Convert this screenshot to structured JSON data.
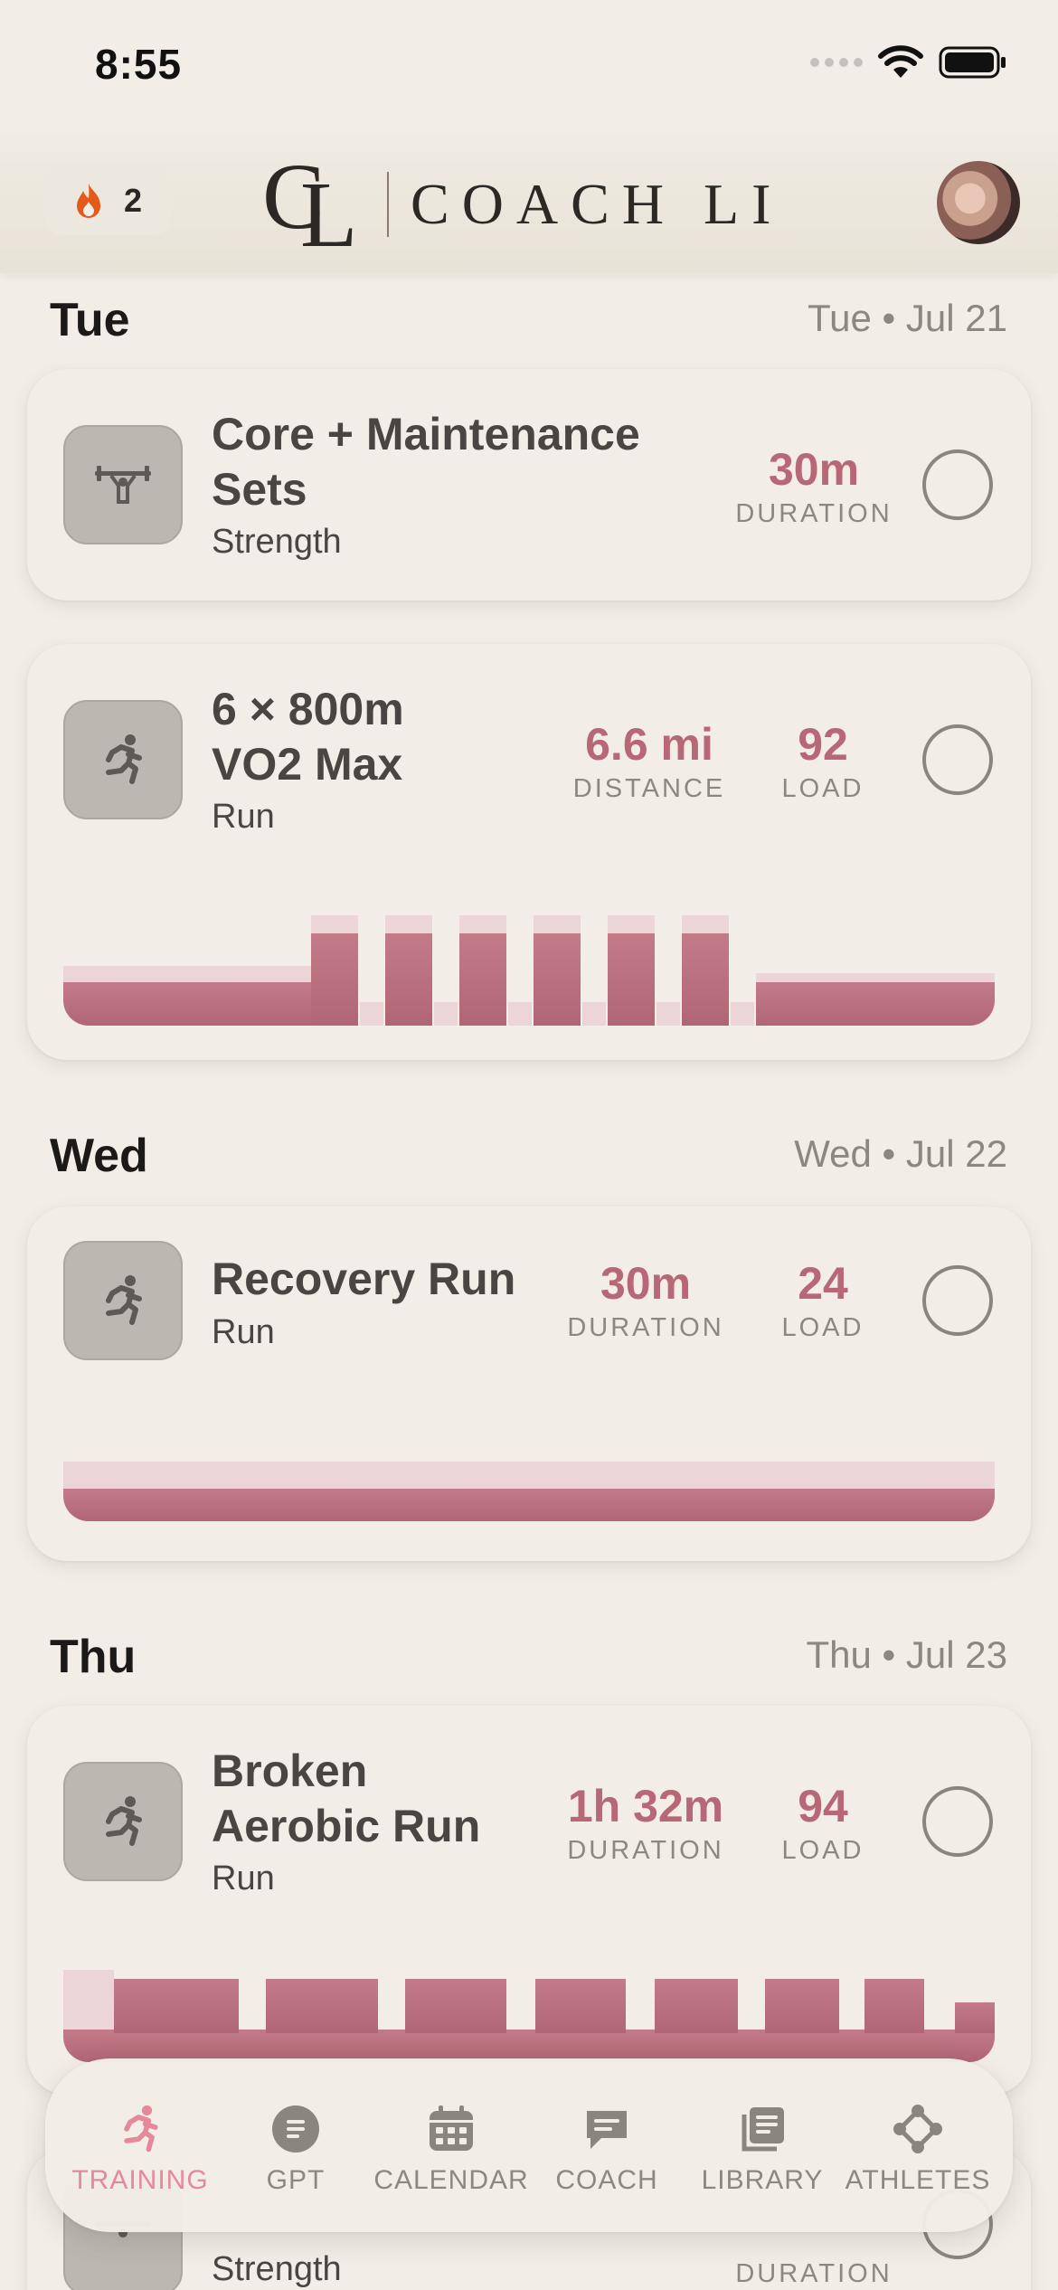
{
  "status": {
    "time": "8:55"
  },
  "header": {
    "streak_count": "2",
    "logo_text": "COACH LI",
    "logo_monogram_c": "C",
    "logo_monogram_l": "L"
  },
  "colors": {
    "accent": "#b76776",
    "tab_active": "#e4899a",
    "background": "#f2ede6",
    "streak_flame": "#e35a1a"
  },
  "days": [
    {
      "name": "Tue",
      "date": "Tue • Jul 21"
    },
    {
      "name": "Wed",
      "date": "Wed • Jul 22"
    },
    {
      "name": "Thu",
      "date": "Thu • Jul 23"
    }
  ],
  "workouts": [
    {
      "icon": "barbell-icon",
      "title_lines": [
        "Core + Maintenance",
        "Sets"
      ],
      "type": "Strength",
      "metrics": [
        {
          "value": "30m",
          "label": "DURATION"
        }
      ]
    },
    {
      "icon": "runner-icon",
      "title_lines": [
        "6 × 800m",
        "VO2 Max"
      ],
      "type": "Run",
      "metrics": [
        {
          "value": "6.6 mi",
          "label": "DISTANCE"
        },
        {
          "value": "92",
          "label": "LOAD"
        }
      ]
    },
    {
      "icon": "runner-icon",
      "title_lines": [
        "Recovery Run"
      ],
      "type": "Run",
      "metrics": [
        {
          "value": "30m",
          "label": "DURATION"
        },
        {
          "value": "24",
          "label": "LOAD"
        }
      ]
    },
    {
      "icon": "runner-icon",
      "title_lines": [
        "Broken",
        "Aerobic Run"
      ],
      "type": "Run",
      "metrics": [
        {
          "value": "1h 32m",
          "label": "DURATION"
        },
        {
          "value": "94",
          "label": "LOAD"
        }
      ]
    },
    {
      "icon": "barbell-icon",
      "type": "Strength",
      "metrics": [
        {
          "label": "DURATION"
        }
      ]
    }
  ],
  "tabs": [
    {
      "label": "TRAINING",
      "icon": "runner-icon",
      "active": true
    },
    {
      "label": "GPT",
      "icon": "gpt-icon"
    },
    {
      "label": "CALENDAR",
      "icon": "calendar-icon"
    },
    {
      "label": "COACH",
      "icon": "chat-icon"
    },
    {
      "label": "LIBRARY",
      "icon": "library-icon"
    },
    {
      "label": "ATHLETES",
      "icon": "athletes-icon"
    }
  ]
}
